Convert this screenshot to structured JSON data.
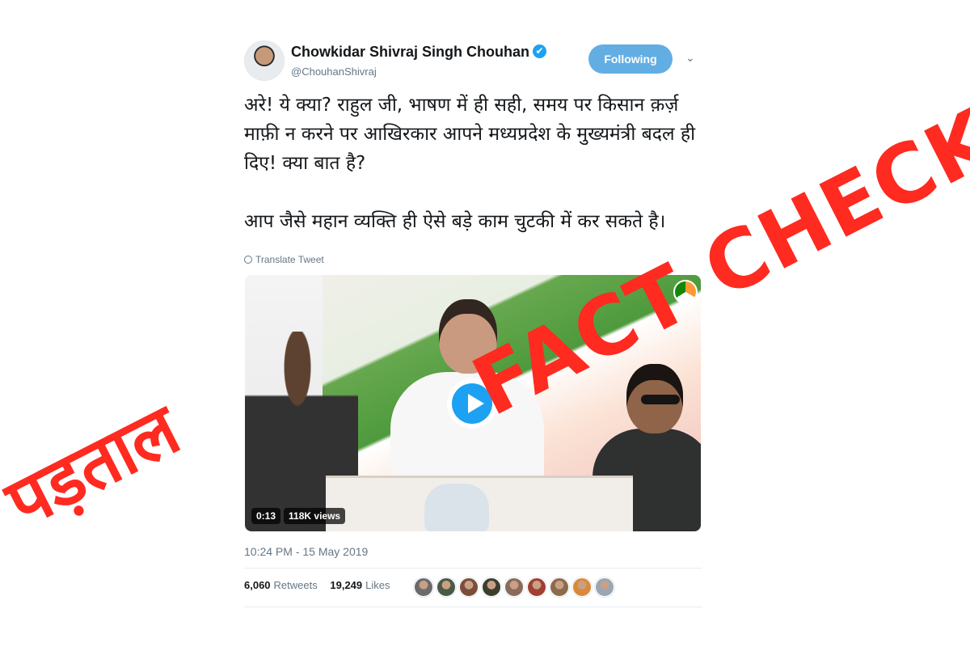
{
  "tweet": {
    "author_name": "Chowkidar Shivraj Singh Chouhan",
    "verified_icon": "✔",
    "handle": "@ChouhanShivraj",
    "follow_label": "Following",
    "menu_icon": "⌄",
    "paragraphs": [
      "अरे! ये क्या? राहुल जी, भाषण में ही सही, समय पर किसान क़र्ज़ माफ़ी न करने पर आखिरकार आपने मध्यप्रदेश के मुख्यमंत्री बदल ही दिए! क्या बात है?",
      "आप जैसे महान व्यक्ति ही ऐसे बड़े काम चुटकी में कर सकते है।"
    ],
    "translate_label": "Translate Tweet",
    "video": {
      "duration": "0:13",
      "views": "118K views"
    },
    "timestamp": "10:24 PM - 15 May 2019",
    "retweets_count": "6,060",
    "retweets_label": "Retweets",
    "likes_count": "19,249",
    "likes_label": "Likes",
    "liker_avatar_colors": [
      "#6b6b6b",
      "#4a5a45",
      "#7a4e3a",
      "#3d3d2e",
      "#8a6a5a",
      "#a04030",
      "#8b6b4b",
      "#d88a3a",
      "#9aa6b2"
    ]
  },
  "overlay": {
    "stamp_hindi": "पड़ताल",
    "stamp_english": "FACT CHECK",
    "stamp_color": "#ff2a20"
  },
  "colors": {
    "accent": "#1da1f2",
    "follow_button": "#62aee3",
    "secondary_text": "#657786"
  }
}
